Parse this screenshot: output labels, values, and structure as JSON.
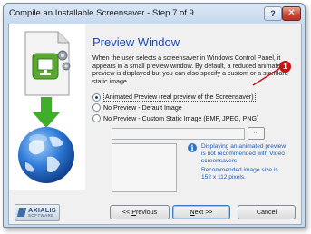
{
  "window": {
    "title": "Compile an Installable Screensaver - Step 7 of 9"
  },
  "titlebar": {
    "help_label": "?",
    "close_label": "✕"
  },
  "page": {
    "title": "Preview Window",
    "description": "When the user selects a screensaver in Windows Control Panel, it appears in a small preview window. By default, a reduced animated preview is displayed but you can also specify a custom or a standard static image."
  },
  "options": [
    {
      "label": "Animated Preview (real preview of the Screensaver)",
      "checked": true
    },
    {
      "label": "No Preview - Default Image",
      "checked": false
    },
    {
      "label": "No Preview - Custom Static Image (BMP, JPEG, PNG)",
      "checked": false
    }
  ],
  "custom_image": {
    "path_value": "",
    "browse_label": "..."
  },
  "info": {
    "icon": "info-icon",
    "message": "Displaying an animated preview is not recommended with Video screensavers.",
    "size_note": "Recommended image size is 152 x 112 pixels."
  },
  "footer": {
    "logo_name": "AXIALIS",
    "logo_sub": "SOFTWARE",
    "previous": {
      "prefix": "<< ",
      "mnemonic": "P",
      "rest": "revious"
    },
    "next": {
      "mnemonic": "N",
      "rest": "ext >>"
    },
    "cancel_label": "Cancel"
  },
  "callout": {
    "number": "1"
  },
  "colors": {
    "title_blue": "#1a4ca8",
    "info_blue": "#1f5fb8",
    "callout_red": "#c11616"
  }
}
